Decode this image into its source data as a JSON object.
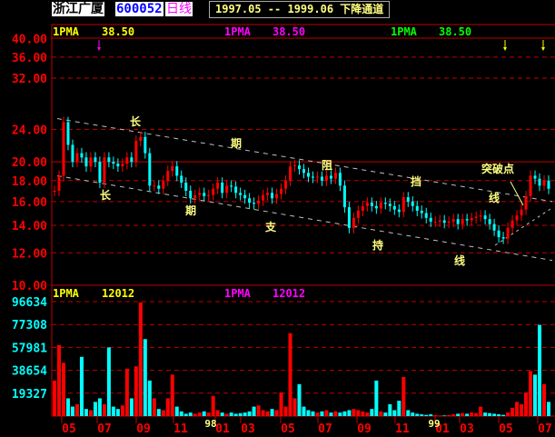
{
  "header": {
    "stock_name": "浙江广厦",
    "stock_code": "600052",
    "period": "日线",
    "range_label": "1997.05 -- 1999.06   下降通道"
  },
  "price_panel": {
    "indicators": [
      {
        "label": "1PMA",
        "value": "38.50",
        "color": "#ffff00"
      },
      {
        "label": "1PMA",
        "value": "38.50",
        "color": "#ff00ff"
      },
      {
        "label": "1PMA",
        "value": "38.50",
        "color": "#00ff00"
      }
    ],
    "y_ticks": [
      "40.00",
      "36.00",
      "32.00",
      "24.00",
      "20.00",
      "18.00",
      "16.00",
      "14.00",
      "12.00",
      "10.00"
    ],
    "annotations": {
      "upper": [
        "长",
        "期",
        "阻",
        "挡",
        "线"
      ],
      "lower": [
        "长",
        "期",
        "支",
        "持",
        "线"
      ],
      "breakout": "突破点"
    }
  },
  "volume_panel": {
    "indicators": [
      {
        "label": "1PMA",
        "value": "12012",
        "color": "#ffff00"
      },
      {
        "label": "1PMA",
        "value": "12012",
        "color": "#ff00ff"
      }
    ],
    "y_ticks": [
      "96634",
      "77308",
      "57981",
      "38654",
      "19327"
    ]
  },
  "x_axis": {
    "labels": [
      "05",
      "07",
      "09",
      "11",
      "01",
      "03",
      "05",
      "07",
      "09",
      "11",
      "01",
      "03",
      "05",
      "07"
    ],
    "year_markers": [
      "98",
      "99"
    ]
  },
  "colors": {
    "up": "#ff0000",
    "down": "#00ffff",
    "grid": "#c00000",
    "axis_price": "#ff0000",
    "axis_volume": "#00ffff",
    "annotation": "#ffff80",
    "trendline": "#c0c0c0"
  },
  "chart_data": [
    {
      "type": "candlestick",
      "title": "",
      "y_scale": "log",
      "ylim": [
        10,
        40
      ],
      "period": [
        "1997.05",
        "1999.06"
      ],
      "close": [
        17,
        18.5,
        25,
        22,
        20,
        21,
        20.5,
        19.5,
        20.5,
        20,
        17.8,
        20.5,
        20,
        19.8,
        19.5,
        19.8,
        20.5,
        20,
        22.5,
        23,
        21,
        17.5,
        17.5,
        17.2,
        18,
        19,
        19.5,
        18.5,
        17.8,
        17,
        16.3,
        16.6,
        16.8,
        16.5,
        16.6,
        17.2,
        17.8,
        16.8,
        17.5,
        17.4,
        16.8,
        16.6,
        16.3,
        15.9,
        15.8,
        16.1,
        16.6,
        16.8,
        16.3,
        16.7,
        17.2,
        18,
        19.5,
        19.6,
        19.2,
        18.8,
        18.4,
        18.3,
        18.4,
        18,
        18.5,
        18.2,
        18.8,
        17.5,
        15.5,
        13.8,
        14.6,
        15.2,
        15.6,
        15.9,
        15.6,
        15.4,
        15.9,
        15.8,
        15.6,
        15.3,
        15.1,
        16.4,
        16,
        15.6,
        15.2,
        15,
        14.6,
        14.3,
        14.3,
        14.4,
        14.2,
        14.3,
        14.5,
        14.1,
        14.5,
        14.4,
        14.6,
        14.7,
        14.8,
        14.5,
        14.1,
        13.6,
        13.1,
        13,
        13.8,
        14.4,
        14.8,
        15.3,
        16.5,
        18.5,
        18.2,
        17.5,
        18,
        17.2
      ],
      "trendlines": {
        "resistance": [
          25.5,
          16.0
        ],
        "support": [
          18.5,
          11.5
        ]
      }
    },
    {
      "type": "bar",
      "title": "",
      "ylim": [
        0,
        96634
      ],
      "volume": [
        30000,
        60000,
        45000,
        15000,
        8000,
        10000,
        50000,
        6000,
        5000,
        12000,
        15000,
        10000,
        58000,
        8000,
        6000,
        9000,
        40000,
        15000,
        42000,
        96000,
        65000,
        30000,
        15000,
        6000,
        5000,
        15000,
        35000,
        8000,
        4000,
        2000,
        3000,
        2000,
        3000,
        4000,
        3000,
        17000,
        5000,
        3000,
        2000,
        3000,
        2000,
        2500,
        3000,
        4000,
        8000,
        9000,
        5000,
        4000,
        6000,
        5000,
        20000,
        8000,
        70000,
        15000,
        27000,
        8000,
        5000,
        4000,
        3000,
        4000,
        5000,
        3000,
        4000,
        3000,
        4000,
        5000,
        6000,
        5000,
        4000,
        3000,
        6000,
        30000,
        4000,
        3000,
        10000,
        5000,
        13000,
        33000,
        5000,
        3000,
        2000,
        1500,
        1000,
        1500,
        800,
        500,
        500,
        800,
        1500,
        2000,
        2500,
        2000,
        3000,
        2500,
        8000,
        3000,
        2500,
        2000,
        1500,
        1000,
        3000,
        7000,
        12000,
        10000,
        20000,
        38000,
        35000,
        77000,
        27000,
        12000
      ]
    }
  ]
}
